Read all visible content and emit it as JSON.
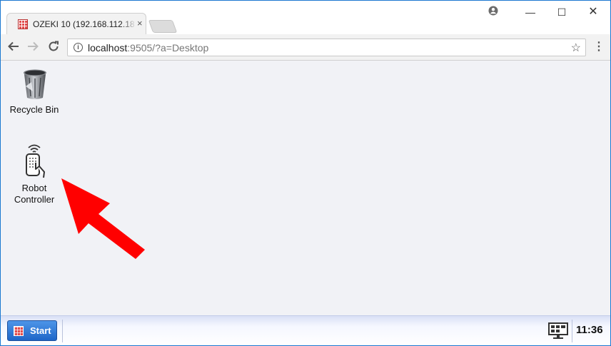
{
  "browser": {
    "tab": {
      "title": "OZEKI 10 (192.168.112.18",
      "close": "×"
    },
    "controls": {
      "minimize": "—",
      "maximize": "☐",
      "close": "✕"
    },
    "url": {
      "host": "localhost",
      "rest": ":9505/?a=Desktop"
    }
  },
  "desktop": {
    "icons": [
      {
        "label": "Recycle Bin"
      },
      {
        "label": "Robot\nController"
      }
    ]
  },
  "taskbar": {
    "start_label": "Start",
    "clock": "11:36"
  },
  "colors": {
    "window_border": "#1b78d0",
    "desktop_bg": "#f1f2f6",
    "arrow": "#ff0000",
    "start_button": "#2a72d4"
  }
}
